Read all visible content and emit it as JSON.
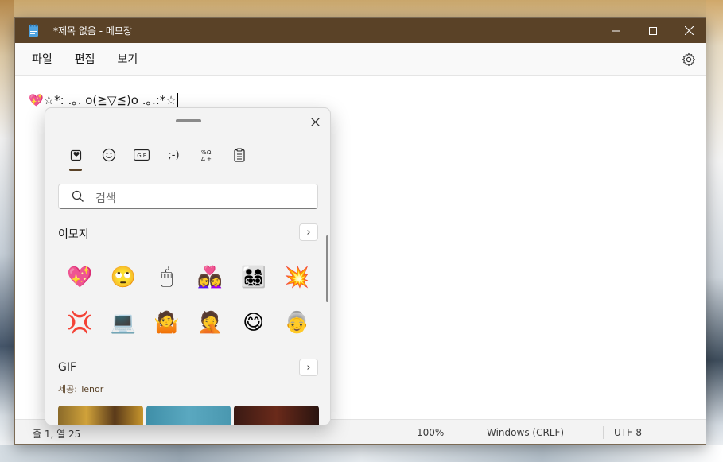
{
  "window": {
    "title": "*제목 없음 - 메모장",
    "controls": {
      "minimize": "minimize-icon",
      "maximize": "maximize-icon",
      "close": "close-icon"
    }
  },
  "menu": {
    "items": [
      "파일",
      "편집",
      "보기"
    ],
    "settings_icon": "gear-icon"
  },
  "editor": {
    "content": "💖☆*: .｡. o(≧▽≦)o .｡.:*☆"
  },
  "status": {
    "position": "줄 1, 열 25",
    "zoom": "100%",
    "line_ending": "Windows (CRLF)",
    "encoding": "UTF-8"
  },
  "emoji_panel": {
    "tabs": [
      {
        "name": "recent-icon",
        "label": ""
      },
      {
        "name": "emoji-icon",
        "label": "☺"
      },
      {
        "name": "gif-icon",
        "label": "GIF"
      },
      {
        "name": "kaomoji-icon",
        "label": ";-)"
      },
      {
        "name": "symbols-icon",
        "label": "%Ω"
      },
      {
        "name": "clipboard-icon",
        "label": ""
      }
    ],
    "search_placeholder": "검색",
    "emoji_section": {
      "title": "이모지",
      "more": "›"
    },
    "emojis": [
      "💖",
      "🙄",
      "🖱",
      "👩‍❤️‍👩",
      "👨‍👩‍👧‍👦",
      "💥",
      "💢",
      "💻",
      "🤷",
      "🤦",
      "😋",
      "👵"
    ],
    "gif_section": {
      "title": "GIF",
      "provider": "제공: Tenor",
      "more": "›"
    },
    "colors": {
      "accent": "#5a4227",
      "titlebar": "#5a4227"
    }
  }
}
